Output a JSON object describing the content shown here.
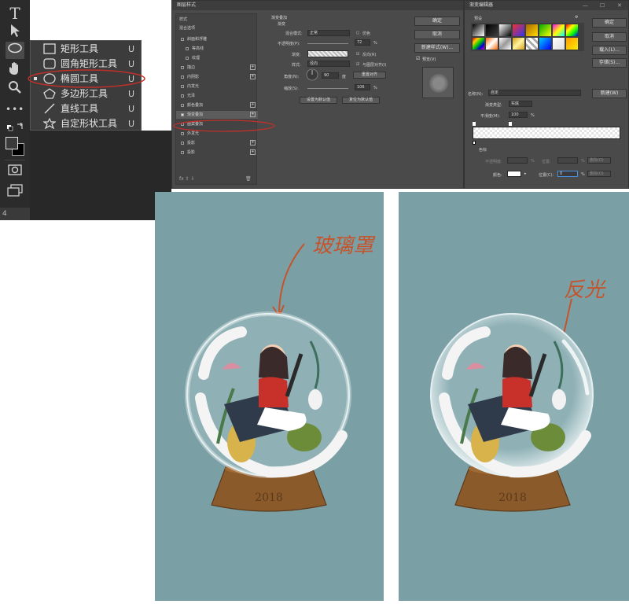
{
  "toolbar": {
    "tools": [
      {
        "name": "type-tool-icon",
        "glyph": "T"
      },
      {
        "name": "path-selection-tool-icon",
        "glyph": "➤"
      },
      {
        "name": "ellipse-tool-icon",
        "glyph": "◯"
      },
      {
        "name": "hand-tool-icon",
        "glyph": "✋"
      },
      {
        "name": "zoom-tool-icon",
        "glyph": "⌕"
      },
      {
        "name": "more-tools-icon",
        "glyph": "•••"
      }
    ],
    "bottom_label": "4"
  },
  "shape_flyout": {
    "items": [
      {
        "label": "矩形工具",
        "key": "U"
      },
      {
        "label": "圆角矩形工具",
        "key": "U"
      },
      {
        "label": "椭圆工具",
        "key": "U"
      },
      {
        "label": "多边形工具",
        "key": "U"
      },
      {
        "label": "直线工具",
        "key": "U"
      },
      {
        "label": "自定形状工具",
        "key": "U"
      }
    ],
    "selected_index": 2
  },
  "layer_style": {
    "title": "图层样式",
    "styles_header": "样式",
    "blend_options": "混合选项",
    "styles": [
      {
        "label": "斜面和浮雕",
        "checked": false,
        "plus": false
      },
      {
        "label": "等高线",
        "checked": false,
        "plus": false
      },
      {
        "label": "纹理",
        "checked": false,
        "plus": false
      },
      {
        "label": "描边",
        "checked": false,
        "plus": true
      },
      {
        "label": "内阴影",
        "checked": false,
        "plus": true
      },
      {
        "label": "内发光",
        "checked": false,
        "plus": false
      },
      {
        "label": "光泽",
        "checked": false,
        "plus": false
      },
      {
        "label": "颜色叠加",
        "checked": false,
        "plus": true
      },
      {
        "label": "渐变叠加",
        "checked": true,
        "plus": true
      },
      {
        "label": "图案叠加",
        "checked": false,
        "plus": false
      },
      {
        "label": "外发光",
        "checked": false,
        "plus": false
      },
      {
        "label": "投影",
        "checked": false,
        "plus": true
      },
      {
        "label": "投影",
        "checked": false,
        "plus": true
      }
    ],
    "section_title": "渐变叠加",
    "subsection": "渐变",
    "blend_mode_label": "混合模式:",
    "blend_mode_value": "正常",
    "dither_label": "仿色",
    "opacity_label": "不透明度(P):",
    "opacity_value": "72",
    "gradient_label": "渐变:",
    "reverse_label": "反向(R)",
    "style_label": "样式:",
    "style_value": "径向",
    "align_label": "与图层对齐(I)",
    "angle_label": "角度(N):",
    "angle_value": "90",
    "angle_unit": "度",
    "reset_align": "重置对齐",
    "scale_label": "缩放(S):",
    "scale_value": "106",
    "percent": "%",
    "set_default": "设置为默认值",
    "reset_default": "复位为默认值",
    "ok": "确定",
    "cancel": "取消",
    "new_style": "新建样式(W)...",
    "preview": "预览(V)"
  },
  "gradient_editor": {
    "title": "渐变编辑器",
    "presets_label": "预设",
    "ok": "确定",
    "cancel": "取消",
    "load": "载入(L)...",
    "save": "存储(S)...",
    "name_label": "名称(N):",
    "name_value": "自定",
    "new": "新建(W)",
    "type_label": "渐变类型:",
    "type_value": "实底",
    "smooth_label": "平滑度(M):",
    "smooth_value": "100",
    "percent": "%",
    "stops_label": "色标",
    "opacity_label": "不透明度:",
    "location_label": "位置:",
    "delete_label": "删除(D)",
    "color_label": "颜色:",
    "color_location_label": "位置(C):",
    "color_location_value": "0",
    "delete_label2": "删除(D)"
  },
  "annotations": {
    "left": "玻璃罩",
    "right": "反光"
  },
  "illustration": {
    "year_left": "2018",
    "year_right": "2018"
  },
  "colors": {
    "panel_bg": "#7aa0a6",
    "annotation": "#c5532b",
    "highlight_ellipse": "#c0302a"
  }
}
